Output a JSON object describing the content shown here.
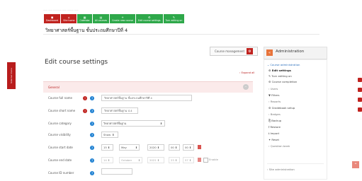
{
  "sidebar": {
    "tab_label": "Side bar menu"
  },
  "topbar": {
    "text": "—— —— ———— —— ——— ——"
  },
  "nav": {
    "buttons": [
      {
        "label": "Dashboard",
        "icon": "dashboard-icon",
        "glyph": "◼",
        "color": "red"
      },
      {
        "label": "Site home",
        "icon": "home-icon",
        "glyph": "⌂",
        "color": "red"
      },
      {
        "label": "Calendar",
        "icon": "calendar-icon",
        "glyph": "▦",
        "color": "green"
      },
      {
        "label": "All courses",
        "icon": "courses-icon",
        "glyph": "▤",
        "color": "green"
      },
      {
        "label": "Create new course",
        "icon": "add-icon",
        "glyph": "+",
        "color": "green"
      },
      {
        "label": "Edit course settings",
        "icon": "settings-icon",
        "glyph": "⚙",
        "color": "green"
      },
      {
        "label": "Turn editing on",
        "icon": "edit-icon",
        "glyph": "✎",
        "color": "green"
      }
    ]
  },
  "course": {
    "title": "วิทยาศาสตร์พื้นฐาน ชั้นประถมศึกษาปีที่ 4"
  },
  "management": {
    "label": "Course management"
  },
  "page": {
    "title": "Edit course settings",
    "expand_all": "› Expand all"
  },
  "general": {
    "label": "General"
  },
  "form": {
    "full_name": {
      "label": "Course full name",
      "value": "วิทยาศาสตร์พื้นฐาน ชั้นประถมศึกษาปีที่ 4"
    },
    "short_name": {
      "label": "Course short name",
      "value": "วิทยาศาสตร์พื้นฐาน ป.4"
    },
    "category": {
      "label": "Course category",
      "value": "วิทยาศาสตร์พื้นฐาน"
    },
    "visibility": {
      "label": "Course visibility",
      "value": "Show"
    },
    "start_date": {
      "label": "Course start date",
      "day": "15",
      "month": "May",
      "year": "2020",
      "hour": "00",
      "minute": "00"
    },
    "end_date": {
      "label": "Course end date",
      "day": "14",
      "month": "October",
      "year": "2021",
      "hour": "23",
      "minute": "57",
      "enable_label": "Enable"
    },
    "id_number": {
      "label": "Course ID number",
      "value": ""
    }
  },
  "admin": {
    "title": "Administration",
    "items": [
      "⌄ Course administration",
      "⚙ Edit settings",
      "✎ Turn editing on",
      "⚙ Course completion",
      "› Users",
      "▼ Filters",
      "› Reports",
      "⚙ Gradebook setup",
      "› Badges",
      "⎘ Backup",
      "⭱ Restore",
      "⭳ Import",
      "✦ Reset",
      "› Question bank",
      "› Site administration"
    ]
  },
  "colors": {
    "accent": "#c0231f",
    "green": "#2ea84a",
    "blue": "#1c7fd1",
    "admin_icon": "#e8743b"
  }
}
